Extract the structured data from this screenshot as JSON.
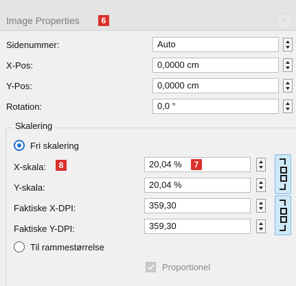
{
  "window": {
    "title": "Image Properties",
    "title_badge": "6",
    "close_glyph": "×"
  },
  "page_fields": [
    {
      "label": "Sidenummer:",
      "value": "Auto"
    },
    {
      "label": "X-Pos:",
      "value": "0,0000 cm"
    },
    {
      "label": "Y-Pos:",
      "value": "0,0000 cm"
    },
    {
      "label": "Rotation:",
      "value": "0,0 °"
    }
  ],
  "scaling": {
    "group_title": "Skalering",
    "free_option": "Fri skalering",
    "x_label": "X-skala:",
    "x_label_badge": "8",
    "x_value": "20,04 %",
    "x_value_badge": "7",
    "y_label": "Y-skala:",
    "y_value": "20,04 %",
    "xdpi_label": "Faktiske X-DPI:",
    "xdpi_value": "359,30",
    "ydpi_label": "Faktiske Y-DPI:",
    "ydpi_value": "359,30",
    "frame_option": "Til rammestørrelse",
    "proportional_label": "Proportionel"
  }
}
